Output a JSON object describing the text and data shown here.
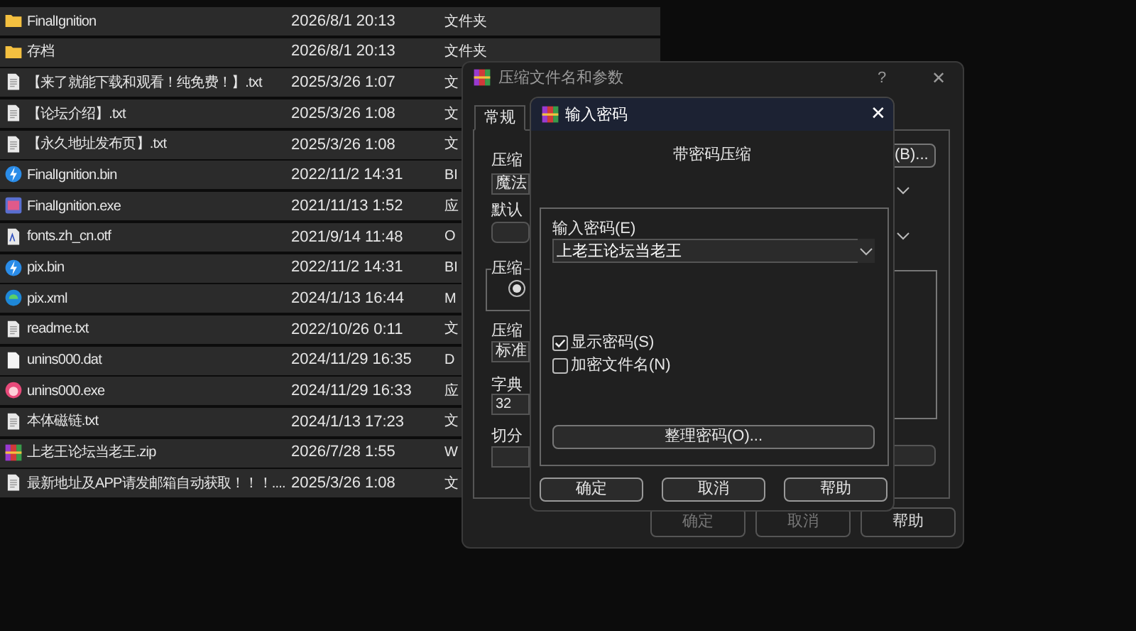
{
  "files": [
    {
      "kind": "folder",
      "name": "FinalIgnition",
      "date": "2026/8/1 20:13",
      "type": "文件夹"
    },
    {
      "kind": "folder",
      "name": "存档",
      "date": "2026/8/1 20:13",
      "type": "文件夹"
    },
    {
      "kind": "text",
      "name": "【来了就能下载和观看！纯免费！】.txt",
      "date": "2025/3/26 1:07",
      "type": "文"
    },
    {
      "kind": "text",
      "name": "【论坛介绍】.txt",
      "date": "2025/3/26 1:08",
      "type": "文"
    },
    {
      "kind": "text",
      "name": "【永久地址发布页】.txt",
      "date": "2025/3/26 1:08",
      "type": "文"
    },
    {
      "kind": "bin",
      "name": "FinalIgnition.bin",
      "date": "2022/11/2 14:31",
      "type": "BI"
    },
    {
      "kind": "exe",
      "name": "FinalIgnition.exe",
      "date": "2021/11/13 1:52",
      "type": "应"
    },
    {
      "kind": "font",
      "name": "fonts.zh_cn.otf",
      "date": "2021/9/14 11:48",
      "type": "O"
    },
    {
      "kind": "bin",
      "name": "pix.bin",
      "date": "2022/11/2 14:31",
      "type": "BI"
    },
    {
      "kind": "web",
      "name": "pix.xml",
      "date": "2024/1/13 16:44",
      "type": "M"
    },
    {
      "kind": "text",
      "name": "readme.txt",
      "date": "2022/10/26 0:11",
      "type": "文"
    },
    {
      "kind": "data",
      "name": "unins000.dat",
      "date": "2024/11/29 16:35",
      "type": "D"
    },
    {
      "kind": "app",
      "name": "unins000.exe",
      "date": "2024/11/29 16:33",
      "type": "应"
    },
    {
      "kind": "text",
      "name": "本体磁链.txt",
      "date": "2024/1/13 17:23",
      "type": "文"
    },
    {
      "kind": "archive",
      "name": "上老王论坛当老王.zip",
      "date": "2026/7/28 1:55",
      "type": "W"
    },
    {
      "kind": "text",
      "name": "最新地址及APP请发邮箱自动获取！！！....",
      "date": "2025/3/26 1:08",
      "type": "文"
    }
  ],
  "archive_dialog": {
    "title": "压缩文件名和参数",
    "help_glyph": "?",
    "close_glyph": "✕",
    "tabs": [
      {
        "label": "常规",
        "selected": true
      }
    ],
    "labels": [
      "压缩",
      "默认",
      "压缩",
      "字典",
      "切分"
    ],
    "group_label": "压缩",
    "archive_name_value": "魔法",
    "browse_button": "(B)...",
    "method_value": "标准",
    "dict_value": "32",
    "radio": {
      "selected": true
    },
    "buttons": [
      "确定",
      "取消",
      "帮助"
    ]
  },
  "password_dialog": {
    "title": "输入密码",
    "close_glyph": "✕",
    "heading": "带密码压缩",
    "field_label": "输入密码(E)",
    "password": "上老王论坛当老王",
    "options": [
      {
        "label": "显示密码(S)",
        "checked": true
      },
      {
        "label": "加密文件名(N)",
        "checked": false
      }
    ],
    "organize_button": "整理密码(O)...",
    "buttons": [
      "确定",
      "取消",
      "帮助"
    ]
  }
}
